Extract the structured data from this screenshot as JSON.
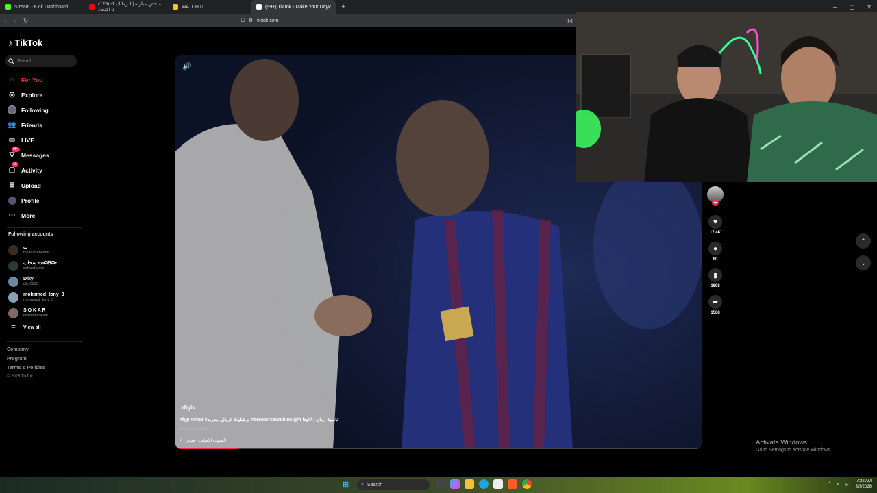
{
  "browser": {
    "tabs": [
      {
        "label": "Stream - Kick Dashboard",
        "color": "#53fc18"
      },
      {
        "label": "(125) ملخص مباراة | الزمالك 1-0 الاتحاد",
        "color": "#ff0000"
      },
      {
        "label": "WATCH IT",
        "color": "#f5c518"
      },
      {
        "label": "(99+) TikTok - Make Your Day",
        "color": "#ffffff",
        "active": true
      }
    ],
    "address": "tiktok.com",
    "new_tab": "+",
    "minimize": "─",
    "maximize": "▢",
    "close": "✕"
  },
  "sidebar": {
    "logo": "TikTok",
    "search_placeholder": "Search",
    "nav": [
      {
        "label": "For You",
        "icon": "home-icon",
        "active": true
      },
      {
        "label": "Explore",
        "icon": "compass-icon"
      },
      {
        "label": "Following",
        "icon": "following-icon"
      },
      {
        "label": "Friends",
        "icon": "friends-icon"
      },
      {
        "label": "LIVE",
        "icon": "live-icon"
      },
      {
        "label": "Messages",
        "icon": "messages-icon",
        "badge": "99+"
      },
      {
        "label": "Activity",
        "icon": "activity-icon",
        "badge": "19"
      },
      {
        "label": "Upload",
        "icon": "upload-icon"
      },
      {
        "label": "Profile",
        "icon": "profile-icon"
      },
      {
        "label": "More",
        "icon": "more-icon"
      }
    ],
    "following_title": "Following accounts",
    "accounts": [
      {
        "name": "ت",
        "handle": "tokaalbrahemm"
      },
      {
        "name": "سحاب •ᔕᗩᗷᗩ•",
        "handle": "sahab1store"
      },
      {
        "name": "Diky",
        "handle": "diky5825"
      },
      {
        "name": "mohamed_tony_3",
        "handle": "mohamed_tony_3"
      },
      {
        "name": "S O K A R",
        "handle": "heshamsokaar"
      }
    ],
    "view_all": "View all",
    "footer": [
      "Company",
      "Program",
      "Terms & Policies"
    ],
    "copyright": "© 2026 TikTok"
  },
  "video": {
    "author": ".s8gik",
    "caption": "#fyp #viral #برشلونة #ريال_مدريد #creatorsearchinsight ناصية زمان | لاليغا",
    "see_translation": "See translation",
    "music": "الصوت الأصلي - ميدو",
    "progress": 0.12
  },
  "actions": {
    "likes": "17.4K",
    "comments": "80",
    "saves": "1698",
    "shares": "1588"
  },
  "watermark": {
    "line1": "Activate Windows",
    "line2": "Go to Settings to activate Windows."
  },
  "taskbar": {
    "search": "Search",
    "time": "7:32 AM",
    "date": "3/7/2026"
  }
}
